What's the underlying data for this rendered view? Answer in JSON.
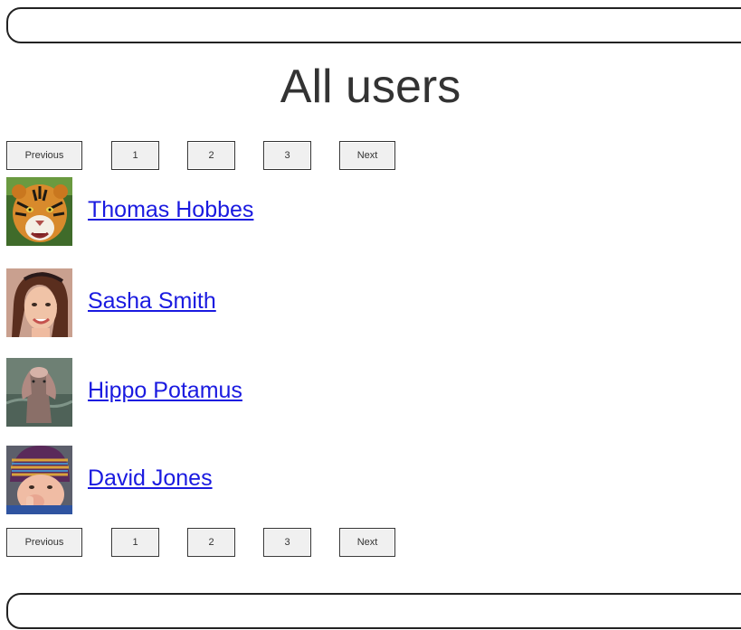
{
  "page": {
    "title": "All users"
  },
  "pagination": {
    "previous_label": "Previous",
    "pages": [
      "1",
      "2",
      "3"
    ],
    "next_label": "Next"
  },
  "users": [
    {
      "name": "Thomas Hobbes",
      "avatar": "tiger-avatar"
    },
    {
      "name": "Sasha Smith",
      "avatar": "woman-portrait-avatar"
    },
    {
      "name": "Hippo Potamus",
      "avatar": "hippo-avatar"
    },
    {
      "name": "David Jones",
      "avatar": "child-in-beanie-avatar"
    }
  ],
  "colors": {
    "link": "#1a1ae0",
    "text": "#333333",
    "button_bg": "#f0f0f0"
  }
}
